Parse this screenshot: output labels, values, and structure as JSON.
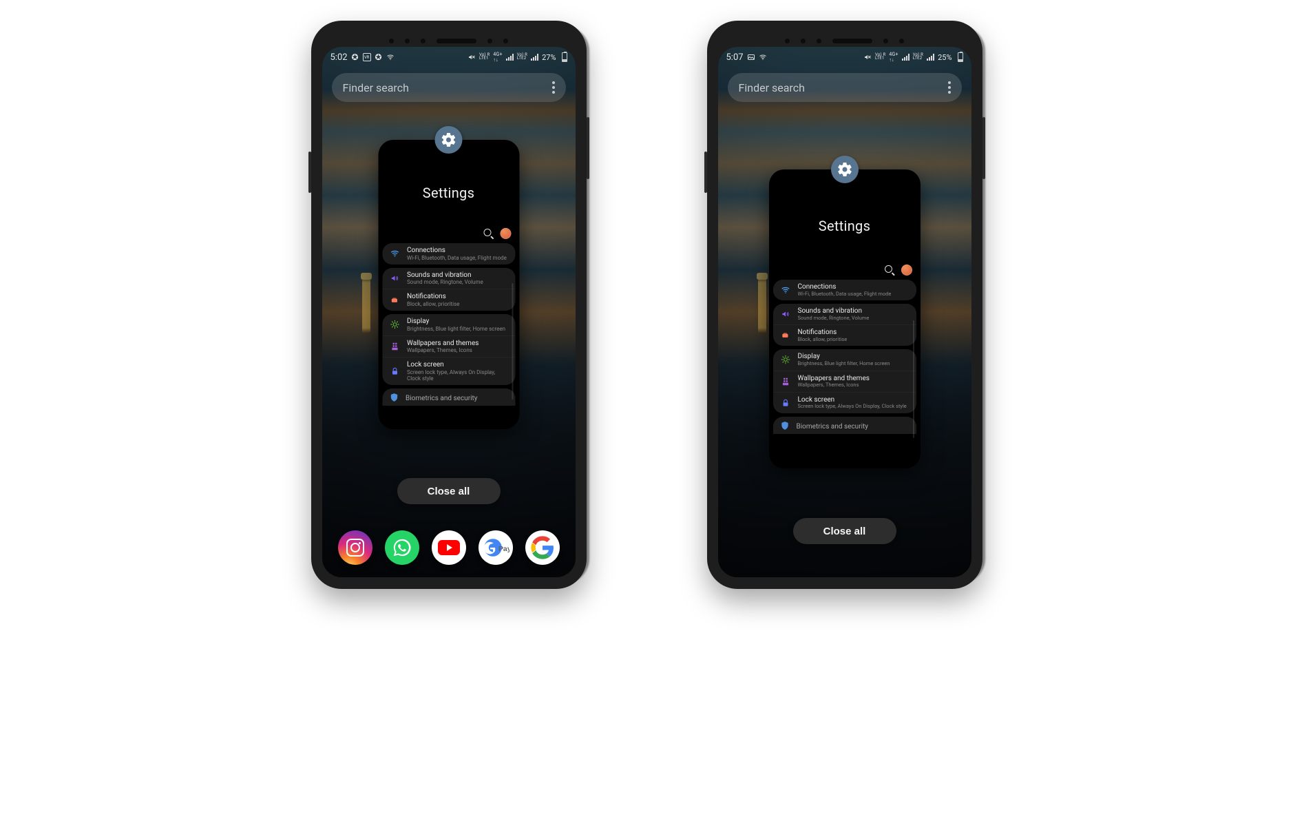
{
  "phones": {
    "left": {
      "time": "5:02",
      "battery_pct": "27%",
      "status_right_labels": {
        "lte1": "Vo) R\nLTE1",
        "gen": "4G+",
        "lte2": "Vo) R\nLTE2"
      },
      "has_dock": true,
      "dock": [
        "Instagram",
        "WhatsApp",
        "YouTube",
        "GPay",
        "Google"
      ]
    },
    "right": {
      "time": "5:07",
      "battery_pct": "25%",
      "status_right_labels": {
        "lte1": "Vo) R\nLTE1",
        "gen": "4G+",
        "lte2": "Vo) R\nLTE2"
      },
      "has_dock": false
    }
  },
  "finder": {
    "placeholder": "Finder search"
  },
  "recents": {
    "app_name": "Settings",
    "close_all": "Close all",
    "items": [
      {
        "icon": "wifi",
        "color": "#4aa3ff",
        "title": "Connections",
        "sub": "Wi-Fi, Bluetooth, Data usage, Flight mode"
      },
      {
        "icon": "sound",
        "color": "#8d5cff",
        "title": "Sounds and vibration",
        "sub": "Sound mode, Ringtone, Volume"
      },
      {
        "icon": "notif",
        "color": "#ff7a59",
        "title": "Notifications",
        "sub": "Block, allow, prioritise"
      },
      {
        "icon": "display",
        "color": "#6ad13a",
        "title": "Display",
        "sub": "Brightness, Blue light filter, Home screen"
      },
      {
        "icon": "theme",
        "color": "#c16bff",
        "title": "Wallpapers and themes",
        "sub": "Wallpapers, Themes, Icons"
      },
      {
        "icon": "lock",
        "color": "#6b7bff",
        "title": "Lock screen",
        "sub": "Screen lock type, Always On Display, Clock style"
      }
    ],
    "partial_next": "Biometrics and security",
    "groups": [
      [
        0
      ],
      [
        1,
        2
      ],
      [
        3,
        4,
        5
      ]
    ]
  },
  "icons": {
    "gear": "gear-icon",
    "search": "search-icon",
    "avatar": "avatar-icon",
    "overflow": "overflow-menu-icon",
    "mute": "mute-icon",
    "wifi": "wifi-icon",
    "sound": "sound-icon",
    "notif": "notification-icon",
    "display": "display-icon",
    "theme": "theme-icon",
    "lock": "lock-icon",
    "security": "shield-icon",
    "signal": "signal-icon",
    "battery": "battery-icon",
    "picture": "picture-icon"
  }
}
